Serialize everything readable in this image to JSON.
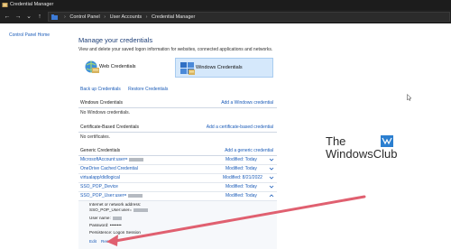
{
  "window": {
    "title": "Credential Manager"
  },
  "navigation": {
    "back_glyph": "←",
    "forward_glyph": "→",
    "recent_glyph": "⌄",
    "up_glyph": "↑",
    "breadcrumbs": [
      "Control Panel",
      "User Accounts",
      "Credential Manager"
    ],
    "separator": "›"
  },
  "left_pane": {
    "home_link": "Control Panel Home"
  },
  "main": {
    "heading": "Manage your credentials",
    "subtext": "View and delete your saved logon information for websites, connected applications and networks.",
    "cred_types": [
      {
        "label": "Web Credentials",
        "icon": "web-credentials-icon",
        "selected": false
      },
      {
        "label": "Windows Credentials",
        "icon": "windows-credentials-icon",
        "selected": true
      }
    ],
    "actions": {
      "backup": "Back up Credentials",
      "restore": "Restore Credentials"
    }
  },
  "sections": {
    "windows": {
      "title": "Windows Credentials",
      "add": "Add a Windows credential",
      "empty": "No Windows credentials."
    },
    "certificate": {
      "title": "Certificate-Based Credentials",
      "add": "Add a certificate-based credential",
      "empty": "No certificates."
    },
    "generic": {
      "title": "Generic Credentials",
      "add": "Add a generic credential",
      "items": [
        {
          "name": "MicrosoftAccount:user=",
          "modified": "Modified:  Today"
        },
        {
          "name": "OneDrive Cached Credential",
          "modified": "Modified:  Today"
        },
        {
          "name": "virtualapp/didlogical",
          "modified": "Modified:  8/21/2022"
        },
        {
          "name": "SSO_POP_Device",
          "modified": "Modified:  Today"
        },
        {
          "name": "SSO_POP_User:user=",
          "modified": "Modified:  Today"
        }
      ],
      "detail": {
        "address_label": "Internet or network address:",
        "address_value": "SSO_POP_User:user=",
        "username_label": "User name:",
        "password_label": "Password: ",
        "password_value": "••••••••",
        "persistence": "Persistence:  Logon Session",
        "edit": "Edit",
        "remove": "Remove"
      }
    }
  },
  "watermark": {
    "line1": "The",
    "line2": "WindowsClub"
  },
  "colors": {
    "link": "#1a5bb8",
    "heading": "#1e3f78",
    "selected_bg": "#d5e8fb",
    "arrow": "#e06070"
  }
}
